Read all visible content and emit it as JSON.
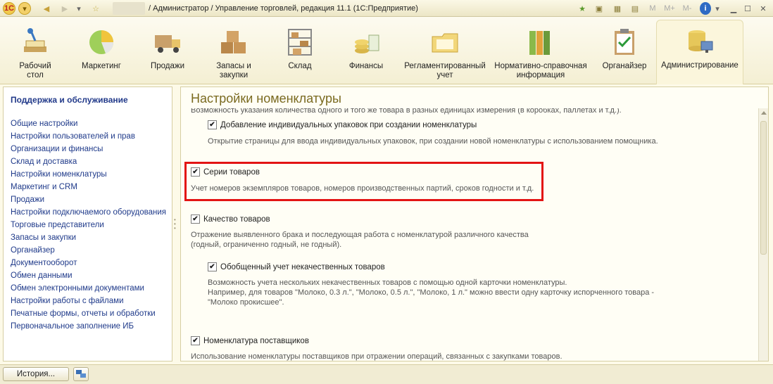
{
  "titlebar": {
    "app_logo": "1С",
    "title": "/ Администратор / Управление торговлей, редакция 11.1  (1С:Предприятие)",
    "icons": [
      "back-arrow",
      "forward-arrow",
      "star",
      "favorites",
      "bookmark",
      "calculator",
      "calendar",
      "info"
    ],
    "memory_buttons": [
      "M",
      "M+",
      "M-"
    ]
  },
  "sections": [
    {
      "label_1": "Рабочий",
      "label_2": "стол",
      "icon": "desktop-icon"
    },
    {
      "label_1": "Маркетинг",
      "label_2": "",
      "icon": "pie-chart-icon"
    },
    {
      "label_1": "Продажи",
      "label_2": "",
      "icon": "truck-icon"
    },
    {
      "label_1": "Запасы и",
      "label_2": "закупки",
      "icon": "boxes-icon"
    },
    {
      "label_1": "Склад",
      "label_2": "",
      "icon": "warehouse-icon"
    },
    {
      "label_1": "Финансы",
      "label_2": "",
      "icon": "coins-icon"
    },
    {
      "label_1": "Регламентированный",
      "label_2": "учет",
      "icon": "folder-icon"
    },
    {
      "label_1": "Нормативно-справочная",
      "label_2": "информация",
      "icon": "binders-icon"
    },
    {
      "label_1": "Органайзер",
      "label_2": "",
      "icon": "clipboard-icon"
    },
    {
      "label_1": "Администрирование",
      "label_2": "",
      "icon": "database-icon"
    }
  ],
  "sidebar": {
    "header": "Поддержка и обслуживание",
    "items": [
      "Общие настройки",
      "Настройки пользователей и прав",
      "Организации и финансы",
      "Склад и доставка",
      "Настройки номенклатуры",
      "Маркетинг и CRM",
      "Продажи",
      "Настройки подключаемого оборудования",
      "Торговые представители",
      "Запасы и закупки",
      "Органайзер",
      "Документооборот",
      "Обмен данными",
      "Обмен электронными документами",
      "Настройки работы с файлами",
      "Печатные формы, отчеты и обработки",
      "Первоначальное заполнение ИБ"
    ]
  },
  "main": {
    "title": "Настройки номенклатуры",
    "cut_line": "Возможность указания количества одного и того же товара в разных единицах измерения (в коробках, паллетах и т.д.).",
    "opt_packages": {
      "label": "Добавление индивидуальных упаковок при создании номенклатуры",
      "checked": true,
      "desc": "Открытие страницы для ввода индивидуальных упаковок, при создании новой номенклатуры с использованием помощника."
    },
    "opt_series": {
      "label": "Серии товаров",
      "checked": true,
      "desc": "Учет номеров экземпляров товаров, номеров производственных партий, сроков годности и т.д."
    },
    "opt_quality": {
      "label": "Качество товаров",
      "checked": true,
      "desc_1": "Отражение выявленного брака и последующая работа с номенклатурой различного качества",
      "desc_2": "(годный, ограниченно годный, не годный)."
    },
    "opt_defective": {
      "label": "Обобщенный учет некачественных товаров",
      "checked": true,
      "desc_1": "Возможность учета нескольких некачественных товаров с помощью одной карточки номенклатуры.",
      "desc_2": "Например, для товаров \"Молоко, 0.3 л.\", \"Молоко, 0.5 л.\", \"Молоко, 1 л.\" можно ввести одну карточку испорченного товара -",
      "desc_3": "\"Молоко прокисшее\"."
    },
    "opt_suppliers": {
      "label": "Номенклатура поставщиков",
      "checked": true,
      "desc": "Использование номенклатуры поставщиков при отражении операций, связанных с закупками товаров."
    }
  },
  "bottombar": {
    "history_label": "История..."
  },
  "colors": {
    "highlight": "#e31414",
    "link": "#1f3a8a",
    "title": "#7a6a20"
  }
}
